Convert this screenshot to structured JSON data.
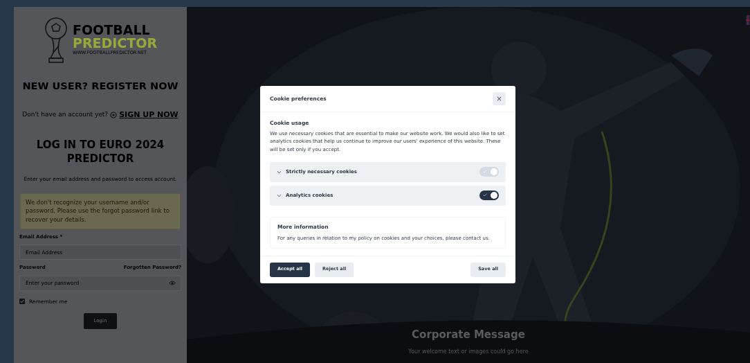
{
  "logo": {
    "title": "FOOTBALL",
    "subtitle": "PREDICTOR",
    "url": "WWW.FOOTBALLPREDICTOR.NET"
  },
  "register": {
    "heading": "NEW USER? REGISTER NOW",
    "prompt": "Don't have an account yet?",
    "link": "SIGN UP NOW"
  },
  "login": {
    "heading": "LOG IN TO EURO 2024 PREDICTOR",
    "intro": "Enter your email address and password to access account.",
    "alert": "We don't recognize your username and/or password. Please use the forgot password link to recover your details.",
    "email": {
      "label": "Email Address *",
      "placeholder": "Email Address"
    },
    "password": {
      "label": "Password",
      "forgot": "Forgotten Password?",
      "placeholder": "Enter your password"
    },
    "remember": {
      "label": "Remember me",
      "checked": true
    },
    "button": "Login"
  },
  "hero": {
    "title": "Corporate Message",
    "text": "Your welcome text or images could go here"
  },
  "cookie_modal": {
    "title": "Cookie preferences",
    "close": "×",
    "section_title": "Cookie usage",
    "description": "We use necessary cookies that are essential to make our website work. We would also like to set analytics cookies that help us continue to improve our users' experience of this website. These will be set only if you accept.",
    "categories": [
      {
        "label": "Strictly necessary cookies",
        "expanded": false,
        "on": true,
        "disabled": true
      },
      {
        "label": "Analytics cookies",
        "expanded": false,
        "on": true,
        "disabled": false
      }
    ],
    "more_info": {
      "title": "More information",
      "text": "For any queries in relation to my policy on cookies and your choices, please contact us."
    },
    "buttons": [
      {
        "label": "Accept all",
        "kind": "primary"
      },
      {
        "label": "Reject all",
        "kind": "secondary"
      },
      {
        "label": "Save all",
        "kind": "secondary"
      }
    ]
  }
}
